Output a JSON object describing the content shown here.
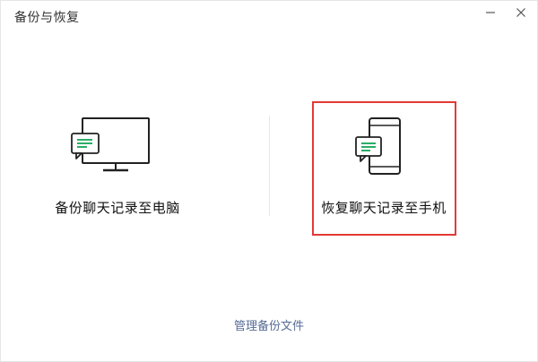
{
  "window": {
    "title": "备份与恢复"
  },
  "options": {
    "backup_label": "备份聊天记录至电脑",
    "restore_label": "恢复聊天记录至手机"
  },
  "footer": {
    "manage_link": "管理备份文件"
  },
  "icons": {
    "backup": "monitor-chat-icon",
    "restore": "phone-chat-icon",
    "minimize": "minimize-icon",
    "close": "close-icon"
  },
  "colors": {
    "accent_green": "#2aae67",
    "highlight_red": "#e53935",
    "link_blue": "#576b95"
  }
}
